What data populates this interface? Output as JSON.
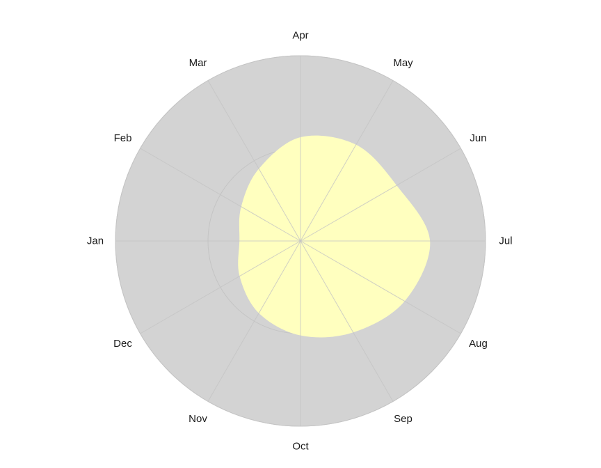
{
  "chart_data": {
    "type": "radar",
    "categories": [
      "Jan",
      "Feb",
      "Mar",
      "Apr",
      "May",
      "Jun",
      "Jul",
      "Aug",
      "Sep",
      "Oct",
      "Nov",
      "Dec"
    ],
    "series": [
      {
        "values": [
          0.33,
          0.37,
          0.45,
          0.56,
          0.6,
          0.6,
          0.7,
          0.65,
          0.57,
          0.51,
          0.45,
          0.38
        ],
        "color": "#ffffbf"
      }
    ],
    "rlim": [
      0,
      1
    ],
    "grid_rings": [
      0.5,
      1.0
    ],
    "grid": true,
    "background_color": "#d3d3d3",
    "grid_color": "#c4c4c4"
  }
}
